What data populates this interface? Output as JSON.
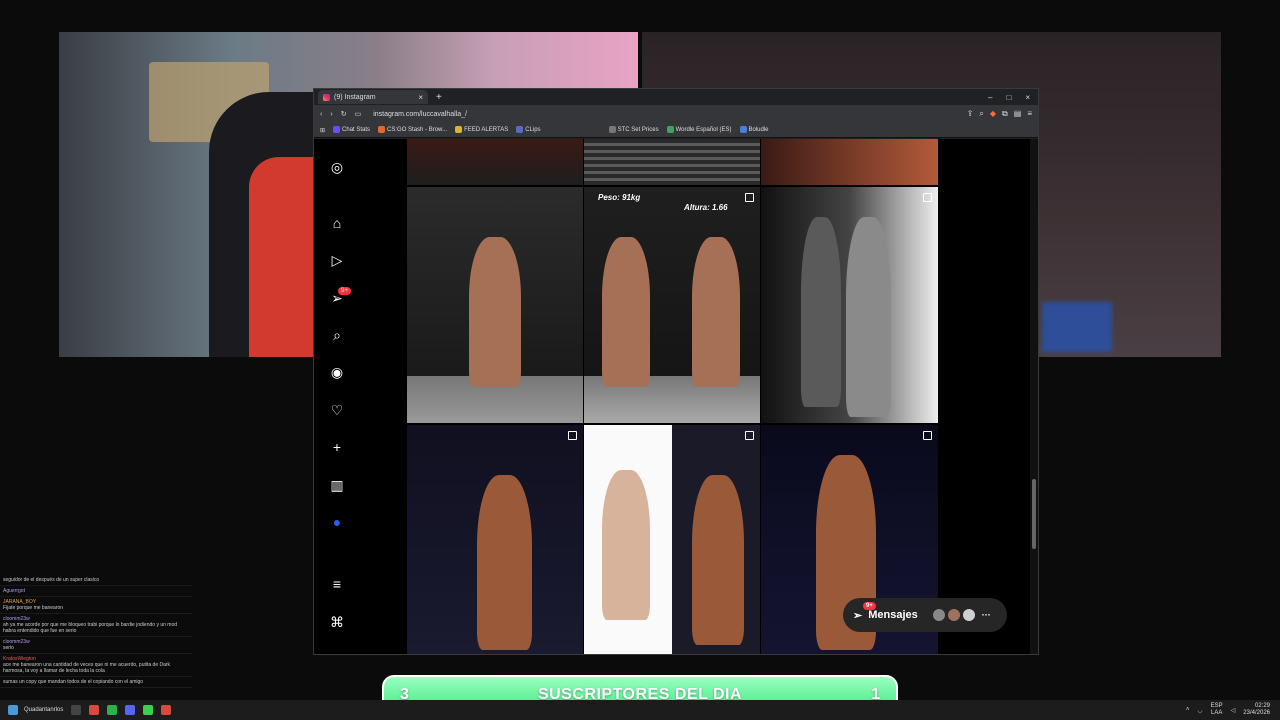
{
  "browser": {
    "tab_title": "(9) Instagram",
    "url": "instagram.com/luccavalhalla_/",
    "bookmarks": [
      "Chat Stats",
      "CS:GO Stash - Brow...",
      "FEED ALERTAS",
      "CLips",
      "STC Set Prices",
      "Wordle Español (ES)",
      "Boludle"
    ]
  },
  "instagram": {
    "notifications_badge": "9+",
    "messages_label": "Mensajes",
    "messages_badge": "9+",
    "post_overlay_text": [
      "Peso: 91kg",
      "Altura: 1.66"
    ]
  },
  "chat": {
    "lines": [
      {
        "user": "",
        "text": "seguidor de el después de un super clasico"
      },
      {
        "user": "Aguerrgot",
        "text": ""
      },
      {
        "user": "JARANA_BOY",
        "text": "Fijate porque me banearon"
      },
      {
        "user": "cloomm23w",
        "text": "ah ya me acorde por que me bloqueo trabi porque lo bardie jodiendo y un mod habra entendido que fue en serio"
      },
      {
        "user": "cloomm23w",
        "text": "serio"
      },
      {
        "user": "KratosWiegton",
        "text": "ace me banearon una cantidad de veces que ni me acuerdo, putita de Dark harmosa, la voy a llamar de lecha toda la cola"
      },
      {
        "user": "",
        "text": "sumas un copy que mandan todos de el copiando con el amigo"
      }
    ]
  },
  "subs_bar": {
    "left": "3",
    "title": "SUSCRIPTORES DEL DIA",
    "right": "1"
  },
  "taskbar": {
    "lang": "ESP",
    "lang2": "LAA",
    "time": "02:29",
    "date": "23/4/2026",
    "user": "Quadantanrlos"
  }
}
